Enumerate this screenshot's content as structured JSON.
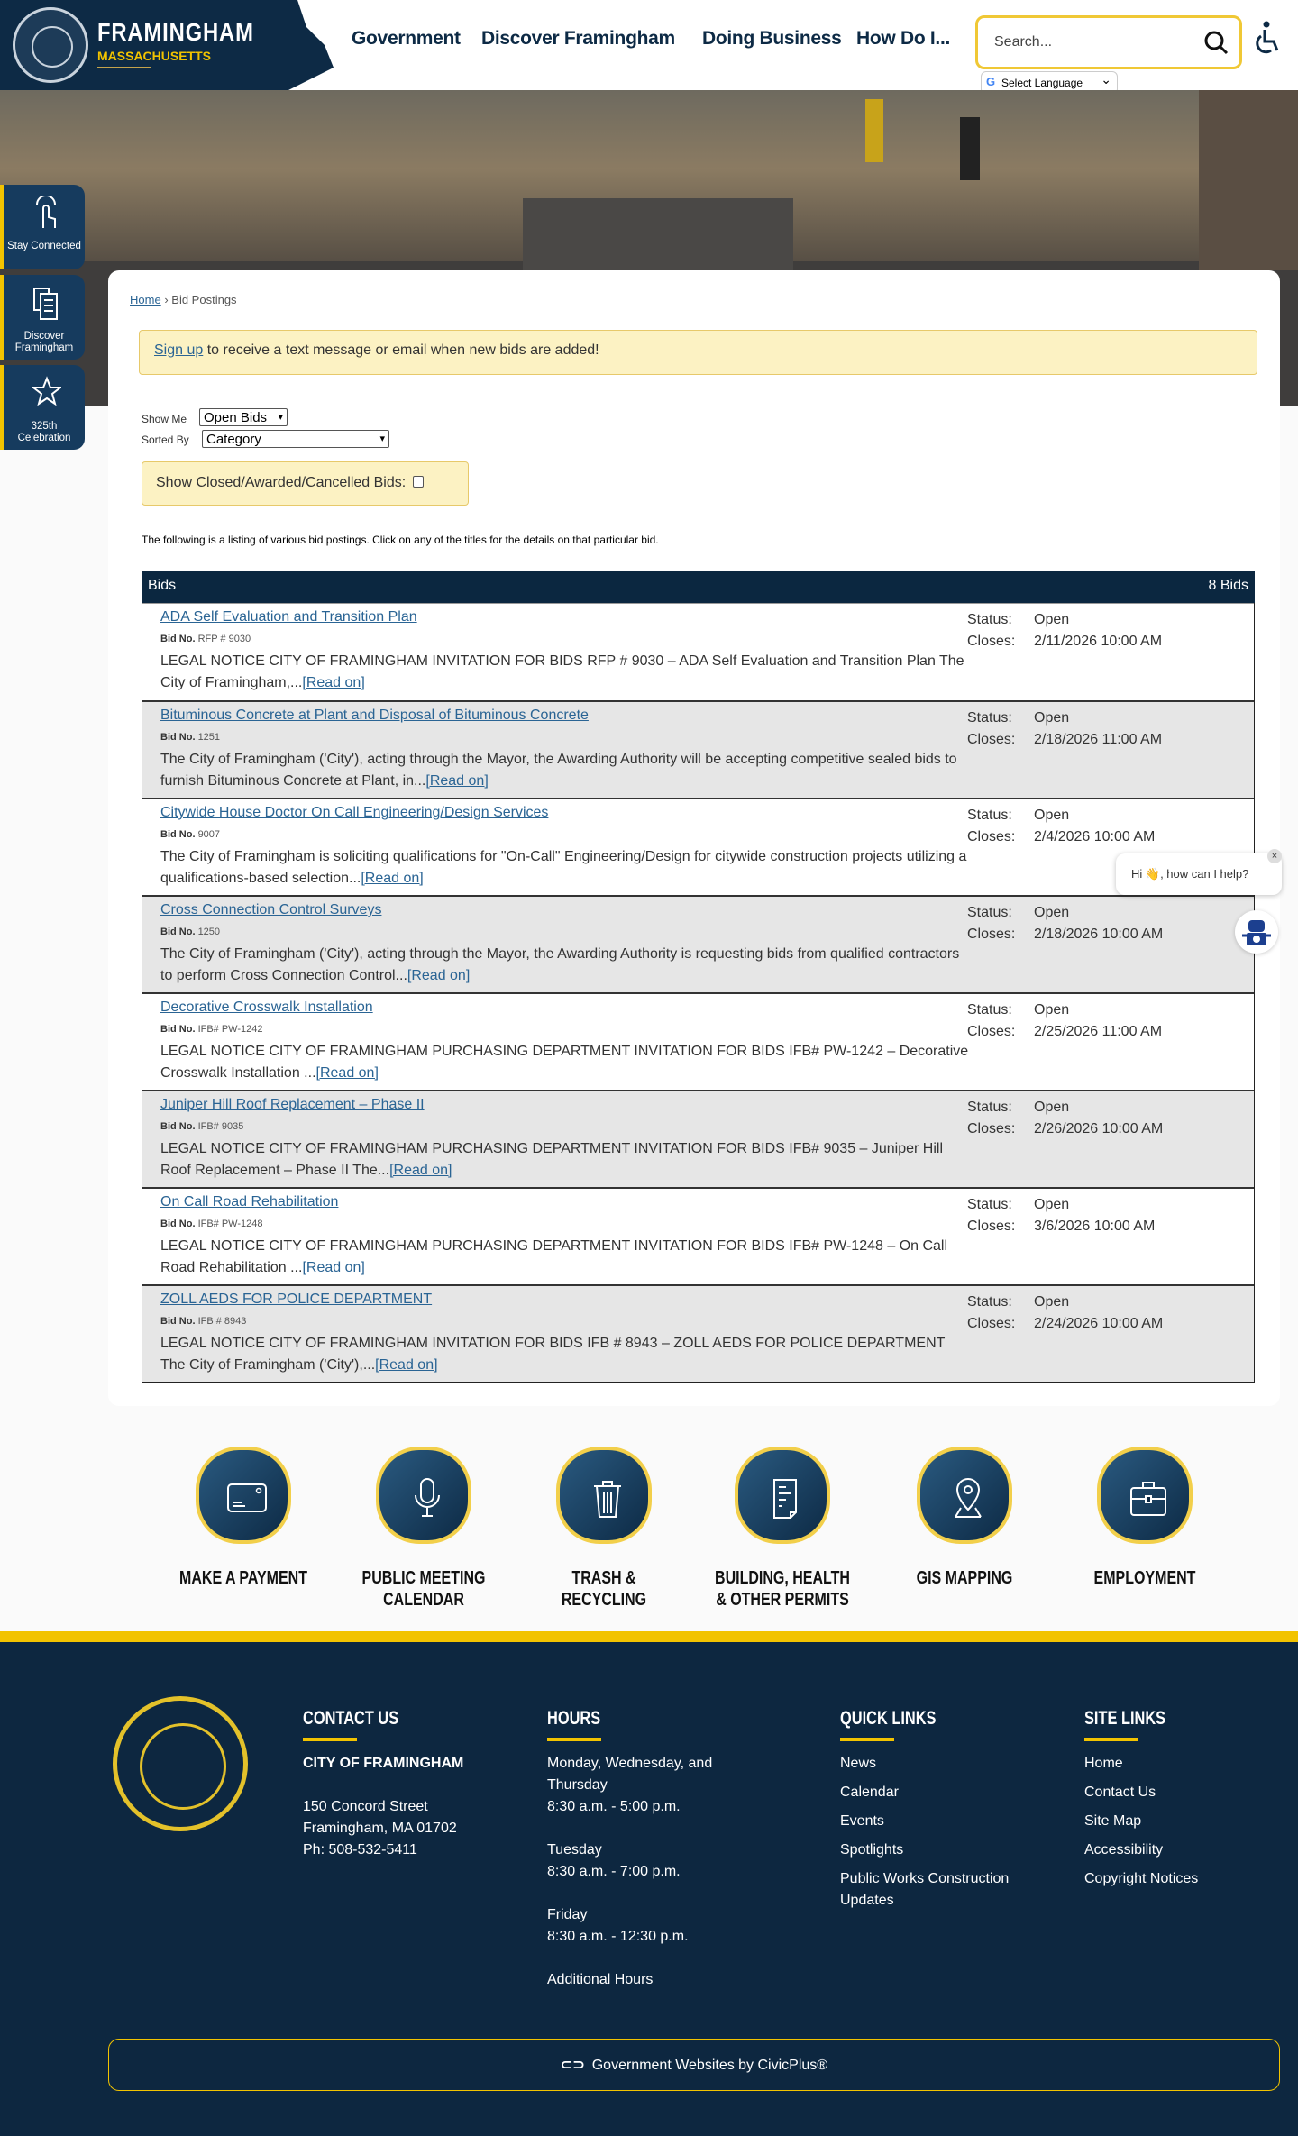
{
  "header": {
    "brand": "FRAMINGHAM",
    "brand_sub": "MASSACHUSETTS",
    "nav": [
      "Government",
      "Discover Framingham",
      "Doing Business",
      "How Do I..."
    ],
    "search_placeholder": "Search...",
    "language": "Select Language"
  },
  "side_tabs": [
    "Stay Connected",
    "Discover Framingham",
    "325th Celebration"
  ],
  "breadcrumb": {
    "home": "Home",
    "sep": "›",
    "current": "Bid Postings"
  },
  "signup": {
    "link": "Sign up",
    "text": " to receive a text message or email when new bids are added!"
  },
  "filters": {
    "show_me_label": "Show Me",
    "show_me_value": "Open Bids",
    "sorted_by_label": "Sorted By",
    "sorted_by_value": "Category",
    "closed_label": "Show Closed/Awarded/Cancelled Bids:"
  },
  "intro": "The following is a listing of various bid postings. Click on any of the titles for the details on that particular bid.",
  "bids_header": {
    "title": "Bids",
    "count": "8 Bids"
  },
  "labels": {
    "bid_no": "Bid No.",
    "status": "Status:",
    "closes": "Closes:",
    "read_on": "[Read on]"
  },
  "bids": [
    {
      "title": "ADA Self Evaluation and Transition Plan",
      "no": "RFP # 9030",
      "status": "Open",
      "closes": "2/11/2026 10:00 AM",
      "desc": "LEGAL NOTICE CITY OF FRAMINGHAM INVITATION FOR BIDS RFP # 9030 – ADA Self Evaluation and Transition Plan The City of Framingham,..."
    },
    {
      "title": "Bituminous Concrete at Plant and Disposal of Bituminous Concrete",
      "no": "1251",
      "status": "Open",
      "closes": "2/18/2026 11:00 AM",
      "desc": "The City of Framingham ('City'), acting through the Mayor, the Awarding Authority will be accepting competitive sealed bids to furnish Bituminous Concrete at Plant, in..."
    },
    {
      "title": "Citywide House Doctor On Call Engineering/Design Services",
      "no": "9007",
      "status": "Open",
      "closes": "2/4/2026 10:00 AM",
      "desc": "The City of Framingham is soliciting qualifications for \"On-Call\" Engineering/Design for citywide construction projects utilizing a qualifications-based selection..."
    },
    {
      "title": "Cross Connection Control Surveys",
      "no": "1250",
      "status": "Open",
      "closes": "2/18/2026 10:00 AM",
      "desc": "The City of Framingham ('City'), acting through the Mayor, the Awarding Authority is requesting bids from qualified contractors to perform Cross Connection Control..."
    },
    {
      "title": "Decorative Crosswalk Installation",
      "no": "IFB# PW-1242",
      "status": "Open",
      "closes": "2/25/2026 11:00 AM",
      "desc": "LEGAL NOTICE CITY OF FRAMINGHAM PURCHASING DEPARTMENT INVITATION FOR BIDS IFB# PW-1242 – Decorative Crosswalk Installation ..."
    },
    {
      "title": "Juniper Hill Roof Replacement – Phase II",
      "no": "IFB# 9035",
      "status": "Open",
      "closes": "2/26/2026 10:00 AM",
      "desc": "LEGAL NOTICE CITY OF FRAMINGHAM PURCHASING DEPARTMENT INVITATION FOR BIDS IFB# 9035 – Juniper Hill Roof Replacement – Phase II The..."
    },
    {
      "title": "On Call Road Rehabilitation",
      "no": "IFB# PW-1248",
      "status": "Open",
      "closes": "3/6/2026 10:00 AM",
      "desc": "LEGAL NOTICE CITY OF FRAMINGHAM PURCHASING DEPARTMENT INVITATION FOR BIDS IFB# PW-1248 – On Call Road Rehabilitation ..."
    },
    {
      "title": "ZOLL AEDS FOR POLICE DEPARTMENT",
      "no": "IFB # 8943",
      "status": "Open",
      "closes": "2/24/2026 10:00 AM",
      "desc": "LEGAL NOTICE CITY OF FRAMINGHAM INVITATION FOR BIDS IFB # 8943 – ZOLL AEDS FOR POLICE DEPARTMENT The City of Framingham ('City'),..."
    }
  ],
  "chat": {
    "greeting": "Hi 👋, how can I help?",
    "close": "×"
  },
  "quick_links": [
    "MAKE A PAYMENT",
    "PUBLIC MEETING CALENDAR",
    "TRASH & RECYCLING",
    "BUILDING, HEALTH & OTHER PERMITS",
    "GIS MAPPING",
    "EMPLOYMENT"
  ],
  "footer": {
    "contact": {
      "heading": "CONTACT US",
      "org": "CITY OF FRAMINGHAM",
      "street": "150 Concord Street",
      "city": "Framingham, MA 01702",
      "phone": "Ph: 508-532-5411"
    },
    "hours": {
      "heading": "HOURS",
      "d1": "Monday, Wednesday, and Thursday",
      "h1": "8:30 a.m. - 5:00 p.m.",
      "d2": "Tuesday",
      "h2": "8:30 a.m. - 7:00 p.m.",
      "d3": "Friday",
      "h3": "8:30 a.m. - 12:30 p.m.",
      "more": "Additional Hours"
    },
    "quick": {
      "heading": "QUICK LINKS",
      "links": [
        "News",
        "Calendar",
        "Events",
        "Spotlights",
        "Public Works Construction Updates"
      ]
    },
    "site": {
      "heading": "SITE LINKS",
      "links": [
        "Home",
        "Contact Us",
        "Site Map",
        "Accessibility",
        "Copyright Notices"
      ]
    },
    "civic": "Government Websites by CivicPlus®"
  },
  "colors": {
    "navy": "#0d2a45",
    "gold": "#f2c300",
    "link": "#2a6494",
    "banner": "#fcf2c3"
  }
}
